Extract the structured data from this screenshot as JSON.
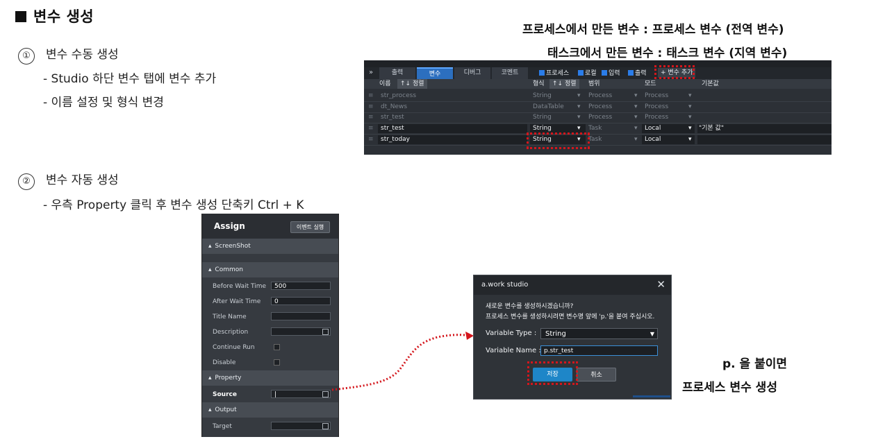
{
  "slide": {
    "title": "변수 생성",
    "step1_num": "①",
    "step1_label": "변수 수동 생성",
    "step1_sub1": "- Studio 하단 변수 탭에 변수 추가",
    "step1_sub2": "- 이름 설정 및 형식 변경",
    "step2_num": "②",
    "step2_label": "변수 자동 생성",
    "step2_sub1": "- 우측 Property 클릭 후 변수 생성 단축키 Ctrl + K",
    "note_process": "프로세스에서 만든 변수 : 프로세스 변수 (전역 변수)",
    "note_task": "태스크에서 만든 변수 : 태스크 변수 (지역 변수)",
    "note_prefix1": "p. 을 붙이면",
    "note_prefix2": "프로세스 변수 생성"
  },
  "variables_panel": {
    "tabs": [
      "출력",
      "변수",
      "디버그",
      "코멘트"
    ],
    "active_tab": "변수",
    "filters": [
      "프로세스",
      "로컬",
      "입력",
      "출력"
    ],
    "add_button": "+ 변수 추가",
    "headers": {
      "name": "이름",
      "sort": "↑↓ 정렬",
      "type": "형식",
      "scope": "범위",
      "mode": "모드",
      "default": "기본값"
    },
    "rows": [
      {
        "name": "str_process",
        "type": "String",
        "scope": "Process",
        "mode": "Process",
        "default": ""
      },
      {
        "name": "dt_News",
        "type": "DataTable",
        "scope": "Process",
        "mode": "Process",
        "default": ""
      },
      {
        "name": "str_test",
        "type": "String",
        "scope": "Process",
        "mode": "Process",
        "default": ""
      },
      {
        "name": "str_test",
        "type": "String",
        "scope": "Task",
        "mode": "Local",
        "default": "\"기본 값\""
      },
      {
        "name": "str_today",
        "type": "String",
        "scope": "Task",
        "mode": "Local",
        "default": ""
      }
    ]
  },
  "assign_panel": {
    "title": "Assign",
    "event_button": "이벤트 실행",
    "sections": {
      "screenshot": "ScreenShot",
      "common": "Common",
      "property": "Property",
      "output": "Output"
    },
    "fields": {
      "before_wait_label": "Before Wait Time",
      "before_wait_value": "500",
      "after_wait_label": "After Wait Time",
      "after_wait_value": "0",
      "title_name_label": "Title Name",
      "description_label": "Description",
      "continue_run_label": "Continue Run",
      "disable_label": "Disable",
      "source_label": "Source",
      "target_label": "Target"
    }
  },
  "dialog": {
    "title": "a.work studio",
    "close": "✕",
    "message1": "새로운 변수를 생성하시겠습니까?",
    "message2": "프로세스 변수를 생성하시려면 변수명 앞에 'p.'을 붙여 주십시오.",
    "type_label": "Variable Type :",
    "type_value": "String",
    "name_label": "Variable Name :",
    "name_value": "p.str_test",
    "ok_button": "저장",
    "cancel_button": "취소"
  },
  "colors": {
    "highlight": "#d4161c",
    "accent": "#1e86c8",
    "panel": "#2c3036"
  }
}
